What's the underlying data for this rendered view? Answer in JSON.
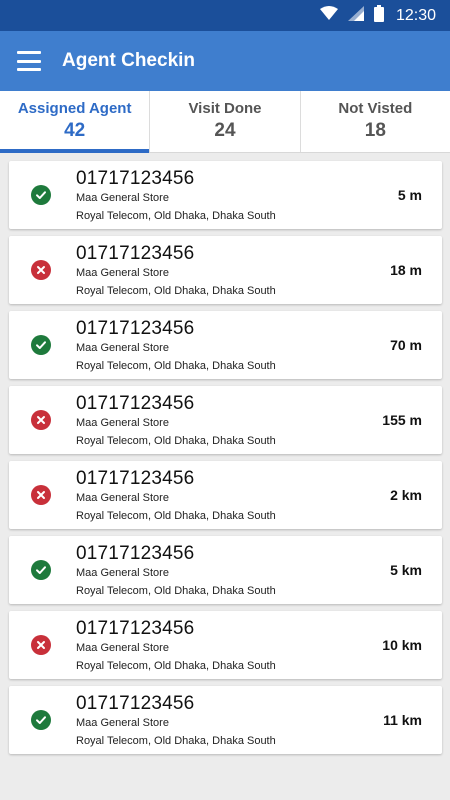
{
  "status_bar": {
    "time": "12:30",
    "icons": [
      "wifi-icon",
      "signal-icon",
      "battery-icon"
    ]
  },
  "app_bar": {
    "title": "Agent Checkin",
    "menu_icon": "hamburger-menu-icon"
  },
  "tabs": [
    {
      "label": "Assigned Agent",
      "count": "42",
      "active": true
    },
    {
      "label": "Visit Done",
      "count": "24",
      "active": false
    },
    {
      "label": "Not Visted",
      "count": "18",
      "active": false
    }
  ],
  "agents": [
    {
      "phone": "01717123456",
      "store": "Maa General Store",
      "address": "Royal Telecom, Old Dhaka, Dhaka South",
      "distance": "5 m",
      "status": "check"
    },
    {
      "phone": "01717123456",
      "store": "Maa General Store",
      "address": "Royal Telecom, Old Dhaka, Dhaka South",
      "distance": "18 m",
      "status": "cross"
    },
    {
      "phone": "01717123456",
      "store": "Maa General Store",
      "address": "Royal Telecom, Old Dhaka, Dhaka South",
      "distance": "70 m",
      "status": "check"
    },
    {
      "phone": "01717123456",
      "store": "Maa General Store",
      "address": "Royal Telecom, Old Dhaka, Dhaka South",
      "distance": "155 m",
      "status": "cross"
    },
    {
      "phone": "01717123456",
      "store": "Maa General Store",
      "address": "Royal Telecom, Old Dhaka, Dhaka South",
      "distance": "2 km",
      "status": "cross"
    },
    {
      "phone": "01717123456",
      "store": "Maa General Store",
      "address": "Royal Telecom, Old Dhaka, Dhaka South",
      "distance": "5 km",
      "status": "check"
    },
    {
      "phone": "01717123456",
      "store": "Maa General Store",
      "address": "Royal Telecom, Old Dhaka, Dhaka South",
      "distance": "10 km",
      "status": "cross"
    },
    {
      "phone": "01717123456",
      "store": "Maa General Store",
      "address": "Royal Telecom, Old Dhaka, Dhaka South",
      "distance": "11 km",
      "status": "check"
    }
  ],
  "colors": {
    "app_bar": "#3f7ece",
    "status_bar": "#1b4f9a",
    "active_tab": "#2e6bc6",
    "check": "#1e7a3c",
    "cross": "#c8303a"
  }
}
